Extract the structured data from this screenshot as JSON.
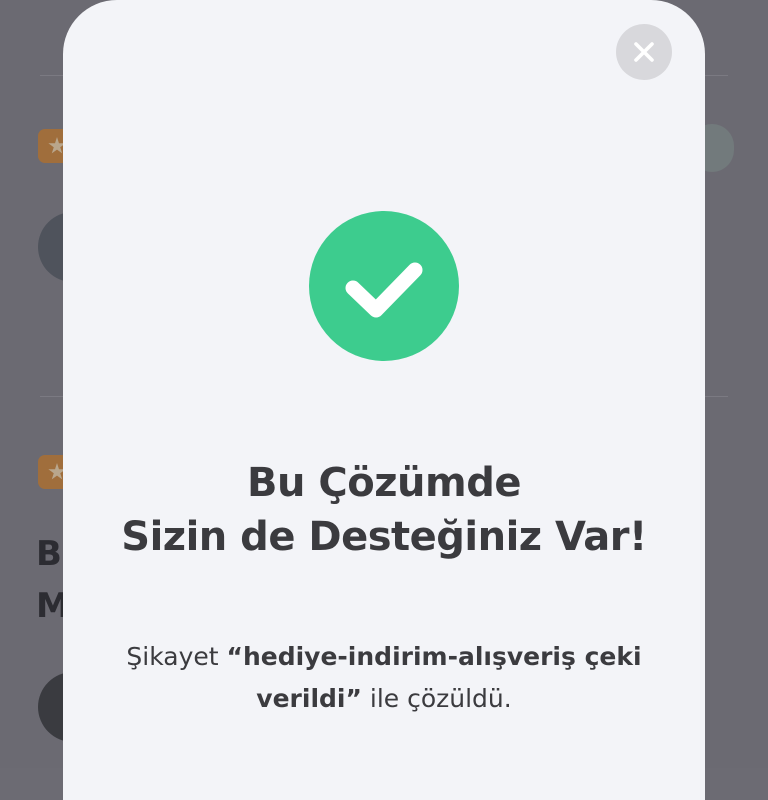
{
  "background": {
    "letters": [
      "B",
      "M"
    ]
  },
  "modal": {
    "close_icon": "close-icon",
    "success_icon": "checkmark-icon",
    "success_color": "#3dcc8e",
    "title_line1": "Bu Çözümde",
    "title_line2": "Sizin de Desteğiniz Var!",
    "message_prefix": "Şikayet ",
    "message_highlight": "“hediye-indirim-alışveriş çeki verildi”",
    "message_suffix": " ile çözüldü."
  }
}
